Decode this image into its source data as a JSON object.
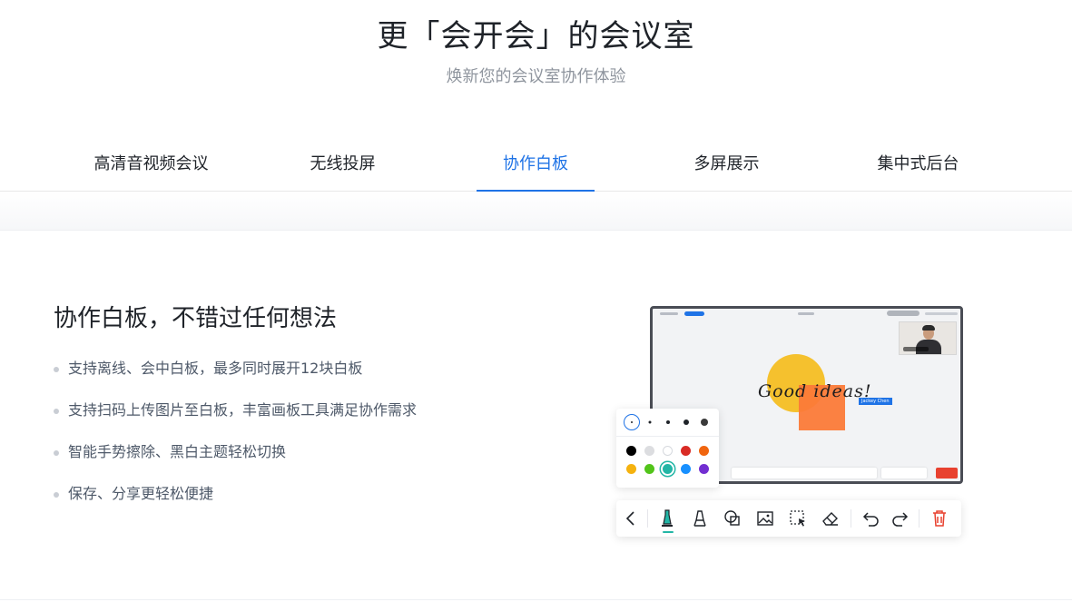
{
  "hero": {
    "title": "更「会开会」的会议室",
    "subtitle": "焕新您的会议室协作体验"
  },
  "tabs": [
    {
      "label": "高清音视频会议",
      "active": false
    },
    {
      "label": "无线投屏",
      "active": false
    },
    {
      "label": "协作白板",
      "active": true
    },
    {
      "label": "多屏展示",
      "active": false
    },
    {
      "label": "集中式后台",
      "active": false
    }
  ],
  "feature": {
    "title": "协作白板，不错过任何想法",
    "points": [
      "支持离线、会中白板，最多同时展开12块白板",
      "支持扫码上传图片至白板，丰富画板工具满足协作需求",
      "智能手势擦除、黑白主题轻松切换",
      "保存、分享更轻松便捷"
    ]
  },
  "whiteboard": {
    "handwriting": "Good ideas!",
    "cursor_name": "Jackey Chen"
  },
  "colors": {
    "accent": "#1f73e6",
    "selected_pen": "#23b6a6",
    "palette": [
      "#000000",
      "#dcdde0",
      "#ffffff",
      "#d92b25",
      "#f0650f",
      "#f5b20f",
      "#52c41a",
      "#23b6a6",
      "#1890ff",
      "#722ed1"
    ]
  },
  "toolbar": {
    "tools": [
      "back-icon",
      "pen-icon",
      "highlighter-icon",
      "shapes-icon",
      "image-icon",
      "select-icon",
      "eraser-icon",
      "undo-icon",
      "redo-icon",
      "delete-icon"
    ]
  }
}
